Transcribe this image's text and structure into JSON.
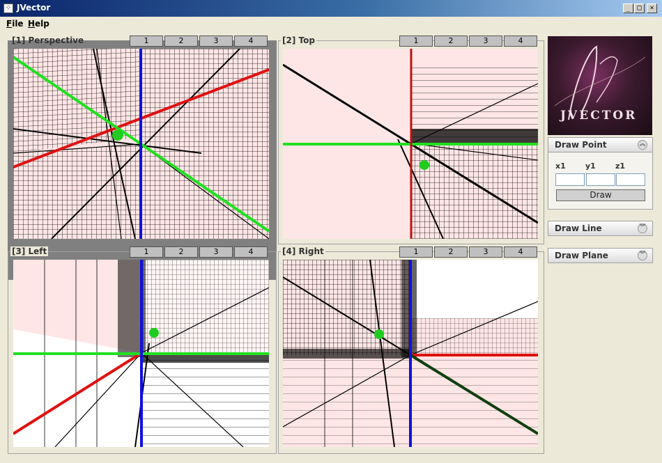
{
  "window": {
    "title": "JVector",
    "app_icon": "app-grid-icon"
  },
  "window_controls": {
    "minimize": "_",
    "maximize": "□",
    "close": "×"
  },
  "menu": {
    "items": [
      "File",
      "Help"
    ]
  },
  "viewports": [
    {
      "title": "[1] Perspective",
      "tabs": [
        "1",
        "2",
        "3",
        "4"
      ]
    },
    {
      "title": "[2] Top",
      "tabs": [
        "1",
        "2",
        "3",
        "4"
      ]
    },
    {
      "title": "[3] Left",
      "tabs": [
        "1",
        "2",
        "3",
        "4"
      ]
    },
    {
      "title": "[4] Right",
      "tabs": [
        "1",
        "2",
        "3",
        "4"
      ]
    }
  ],
  "logo": {
    "text": "JVECTOR"
  },
  "panels": {
    "draw_point": {
      "title": "Draw Point",
      "expanded": true,
      "fields": [
        {
          "label": "x1",
          "value": ""
        },
        {
          "label": "y1",
          "value": ""
        },
        {
          "label": "z1",
          "value": ""
        }
      ],
      "button": "Draw"
    },
    "draw_line": {
      "title": "Draw Line",
      "expanded": false
    },
    "draw_plane": {
      "title": "Draw Plane",
      "expanded": false
    }
  },
  "colors": {
    "x_axis": "#e01010",
    "y_axis": "#20e020",
    "z_axis": "#1010e0",
    "grid": "#000000",
    "canvas_bg": "#ffe6e6",
    "point": "#20cc20"
  }
}
